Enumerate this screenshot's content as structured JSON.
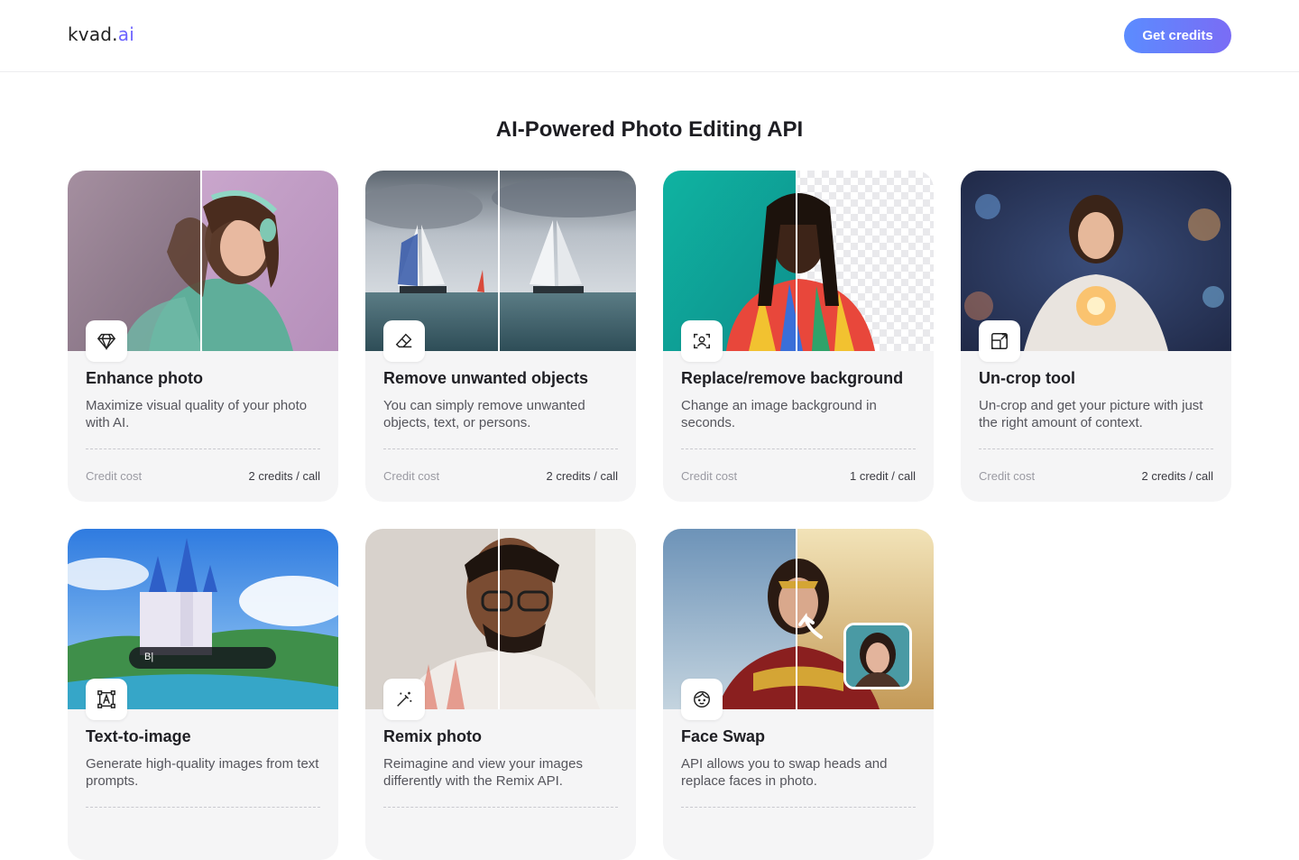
{
  "header": {
    "logo_main": "kvad.",
    "logo_accent": "ai",
    "cta_label": "Get credits"
  },
  "page": {
    "title": "AI-Powered Photo Editing API"
  },
  "cost_label": "Credit cost",
  "cards": [
    {
      "title": "Enhance photo",
      "description": "Maximize visual quality of your photo with AI.",
      "cost": "2 credits / call",
      "icon": "diamond-icon"
    },
    {
      "title": "Remove unwanted objects",
      "description": "You can simply remove unwanted objects, text, or persons.",
      "cost": "2 credits / call",
      "icon": "eraser-icon"
    },
    {
      "title": "Replace/remove background",
      "description": "Change an image background in seconds.",
      "cost": "1 credit / call",
      "icon": "person-focus-icon"
    },
    {
      "title": "Un-crop tool",
      "description": "Un-crop and get your picture with just the right amount of context.",
      "cost": "2 credits / call",
      "icon": "expand-icon"
    },
    {
      "title": "Text-to-image",
      "description": "Generate high-quality images from text prompts.",
      "prompt_text": "B|",
      "icon": "text-frame-icon"
    },
    {
      "title": "Remix photo",
      "description": "Reimagine and view your images differently with the Remix API.",
      "icon": "magic-wand-icon"
    },
    {
      "title": "Face Swap",
      "description": "API allows you to swap heads and replace faces in photo.",
      "icon": "face-icon"
    }
  ],
  "colors": {
    "accent_start": "#5b8cff",
    "accent_end": "#7a6cf5",
    "logo_accent": "#6c63ff",
    "card_bg": "#f5f5f6"
  }
}
